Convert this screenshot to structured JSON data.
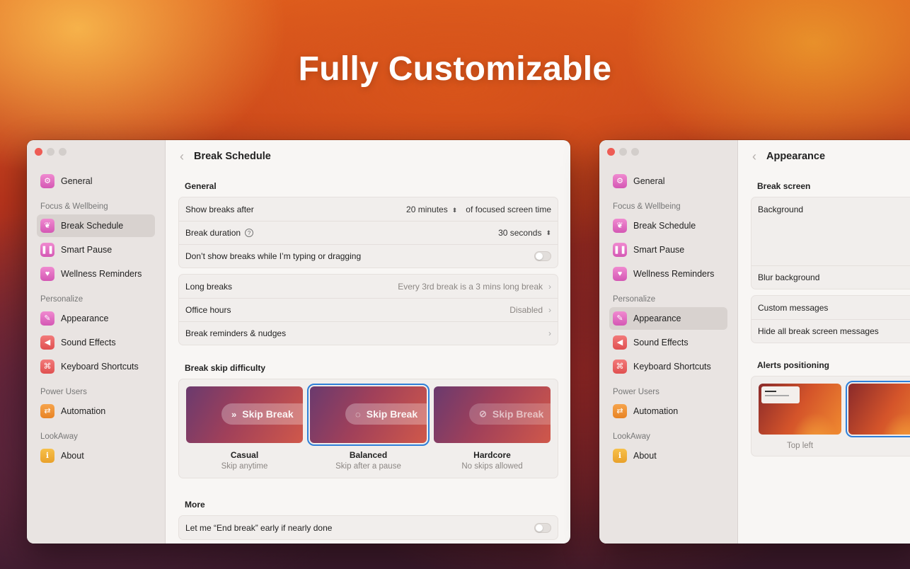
{
  "headline": "Fully Customizable",
  "sidebar": {
    "general": "General",
    "section_focus": "Focus & Wellbeing",
    "break_schedule": "Break Schedule",
    "smart_pause": "Smart Pause",
    "wellness_reminders": "Wellness Reminders",
    "section_personalize": "Personalize",
    "appearance": "Appearance",
    "sound_effects": "Sound Effects",
    "keyboard_shortcuts": "Keyboard Shortcuts",
    "section_power": "Power Users",
    "automation": "Automation",
    "section_lookaway": "LookAway",
    "about": "About"
  },
  "left_window": {
    "title": "Break Schedule",
    "general_header": "General",
    "show_breaks_label": "Show breaks after",
    "show_breaks_value": "20 minutes",
    "show_breaks_suffix": "of focused screen time",
    "break_duration_label": "Break duration",
    "break_duration_value": "30 seconds",
    "typing_label": "Don’t show breaks while I’m typing or dragging",
    "long_breaks_label": "Long breaks",
    "long_breaks_value": "Every 3rd break is a 3 mins long break",
    "office_hours_label": "Office hours",
    "office_hours_value": "Disabled",
    "reminders_label": "Break reminders & nudges",
    "skip_header": "Break skip difficulty",
    "skip_pill_text": "Skip Break",
    "cards": [
      {
        "title": "Casual",
        "subtitle": "Skip anytime"
      },
      {
        "title": "Balanced",
        "subtitle": "Skip after a pause"
      },
      {
        "title": "Hardcore",
        "subtitle": "No skips allowed"
      }
    ],
    "more_header": "More",
    "end_break_label": "Let me “End break” early if nearly done"
  },
  "right_window": {
    "title": "Appearance",
    "break_screen_header": "Break screen",
    "background_label": "Background",
    "blur_label": "Blur background",
    "custom_messages_label": "Custom messages",
    "hide_messages_label": "Hide all break screen messages",
    "alerts_header": "Alerts positioning",
    "position_label": "Top left"
  },
  "colors": {
    "accent": "#2f7fd8",
    "close_button": "#ee5c55"
  }
}
